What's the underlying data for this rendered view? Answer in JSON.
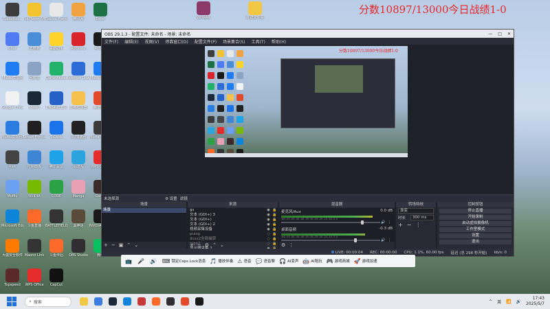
{
  "overlay": {
    "score_text": "分数10897/13000今日战绩1-0"
  },
  "desktop_icons": [
    {
      "label": "Rabbitbo...",
      "color": "#3d3d3d"
    },
    {
      "label": "PotPlayer 64 bit",
      "color": "#f4c430"
    },
    {
      "label": "Roblox Player",
      "color": "#e8e8e8"
    },
    {
      "label": "腾讯网",
      "color": "#f2a341"
    },
    {
      "label": "Excel",
      "color": "#1e7145"
    },
    {
      "label": "Chat",
      "color": "#4f7cf2"
    },
    {
      "label": "此电脑",
      "color": "#4a8ed8"
    },
    {
      "label": "毒霸助手",
      "color": "#ffd42a"
    },
    {
      "label": "Roblox 2",
      "color": "#d8242a"
    },
    {
      "label": "Roblox",
      "color": "#1a1a1a"
    },
    {
      "label": "MuMu模拟器",
      "color": "#1f7cf3"
    },
    {
      "label": "回收站",
      "color": "#8ba4c4"
    },
    {
      "label": "GameViewer",
      "color": "#23b26a"
    },
    {
      "label": "Internet Download...",
      "color": "#2b6cd6"
    },
    {
      "label": "MuMu多开器",
      "color": "#1f7cf3"
    },
    {
      "label": "Google Chrome",
      "color": "#f2f2f2"
    },
    {
      "label": "Steam",
      "color": "#1b2838"
    },
    {
      "label": "DNF系统工具",
      "color": "#2561c7"
    },
    {
      "label": "雷电模拟器",
      "color": "#f6c24d"
    },
    {
      "label": "奥运会...",
      "color": "#e24a2a"
    },
    {
      "label": "MuMu模拟器12",
      "color": "#2a7de1"
    },
    {
      "label": "Street Fighter 6",
      "color": "#202020"
    },
    {
      "label": "ToDesk",
      "color": "#1a73e8"
    },
    {
      "label": "UU加速器",
      "color": "#222"
    },
    {
      "label": "Mortal Kombat",
      "color": "#3a3a3a"
    },
    {
      "label": "Riot",
      "color": "#444"
    },
    {
      "label": "控制面板",
      "color": "#3e86d3"
    },
    {
      "label": "腾讯会议",
      "color": "#1fa3e8"
    },
    {
      "label": "uu远程",
      "color": "#2ba3dc"
    },
    {
      "label": "WPS Office",
      "color": "#e62b2b"
    },
    {
      "label": "MuMu",
      "color": "#6ca0f0"
    },
    {
      "label": "NVIDIA",
      "color": "#76b900"
    },
    {
      "label": "CODE",
      "color": "#2ba245"
    },
    {
      "label": "Manga",
      "color": "#e8a0b4"
    },
    {
      "label": "Game",
      "color": "#3a2a2a"
    },
    {
      "label": "Microsoft Edge",
      "color": "#0c84d9"
    },
    {
      "label": "斗鱼直播",
      "color": "#ff6a2a"
    },
    {
      "label": "BATTLEFIELD",
      "color": "#333"
    },
    {
      "label": "黑神话",
      "color": "#5a4a3a"
    },
    {
      "label": "NVIDIA Broadcast",
      "color": "#1a1a1a"
    },
    {
      "label": "大疆安全软件",
      "color": "#ff7b00"
    },
    {
      "label": "Maono Link",
      "color": "#333"
    },
    {
      "label": "斗鱼伴侣",
      "color": "#ff6a2a"
    },
    {
      "label": "OBS Studio",
      "color": "#302e31"
    },
    {
      "label": "微信",
      "color": "#07c160"
    },
    {
      "label": "Topspeed",
      "color": "#5a2a2a"
    },
    {
      "label": "WPS Office",
      "color": "#e62b2b"
    },
    {
      "label": "CapCut",
      "color": "#111"
    }
  ],
  "top_files": [
    {
      "label": "WinRAR",
      "color": "#8b3a6a"
    },
    {
      "label": "新建文件夹",
      "color": "#f2c744"
    }
  ],
  "obs": {
    "title": "OBS 29.1.3 - 配置文件: 未命名 - 场景: 未命名",
    "menu": [
      "文件(F)",
      "编辑(E)",
      "视图(V)",
      "停靠窗口(D)",
      "配置文件(P)",
      "场景集合(S)",
      "工具(T)",
      "帮助(H)"
    ],
    "preview_score": "分数10897/13000今日战绩1-0",
    "context": {
      "no_source": "未选择源",
      "props": "⚙ 设置",
      "filters": "滤镜"
    },
    "scenes": {
      "title": "场景",
      "items": [
        "场景"
      ]
    },
    "sources": {
      "title": "来源",
      "items": [
        {
          "name": "gs",
          "hidden": false
        },
        {
          "name": "文本 (GDI+) 3",
          "hidden": false
        },
        {
          "name": "文本 (GDI+)",
          "hidden": false
        },
        {
          "name": "文本 (GDI+) 2",
          "hidden": false
        },
        {
          "name": "视频采集设备",
          "hidden": false
        },
        {
          "name": "puisg",
          "hidden": true
        },
        {
          "name": "dcsx2全局捕获",
          "hidden": true
        },
        {
          "name": "rsgo2",
          "hidden": true
        },
        {
          "name": "显示器采集 2",
          "hidden": false
        }
      ]
    },
    "mixer": {
      "title": "混音器",
      "channels": [
        {
          "name": "麦克风/Aux",
          "db": "0.0 dB",
          "level": 0.82
        },
        {
          "name": "桌面音频",
          "db": "-0.3 dB",
          "level": 0.75
        }
      ],
      "scale": "-60 -55 -50 -45 -40 -35 -30 -25 -20 -15 -10 -5 0"
    },
    "transitions": {
      "title": "转场特效",
      "type": "渐变",
      "duration_label": "时长",
      "duration": "300 ms"
    },
    "controls": {
      "title": "控制按钮",
      "buttons": [
        "停止直播",
        "开始录制",
        "启动虚拟摄像机",
        "工作室模式",
        "设置",
        "退出"
      ]
    },
    "status": {
      "live": "LIVE: 00:00:04",
      "rec": "REC: 00:00:00",
      "cpu": "CPU: 1.1%, 60.00 fps",
      "dropped": "延迟 (总 298 秒开始)",
      "kbps": "kb/s: 0"
    }
  },
  "floatbar": [
    {
      "icon": "📺",
      "label": ""
    },
    {
      "icon": "🎤",
      "label": ""
    },
    {
      "icon": "🔊",
      "label": ""
    },
    {
      "icon": "⌨",
      "label": "锁定Caps Lock消息"
    },
    {
      "icon": "🎵",
      "label": "播放伴奏"
    },
    {
      "icon": "⚠",
      "label": "语音"
    },
    {
      "icon": "💬",
      "label": "语音聊"
    },
    {
      "icon": "🎧",
      "label": "AI变声"
    },
    {
      "icon": "🤖",
      "label": "AI陪玩"
    },
    {
      "icon": "🎮",
      "label": "游戏商城"
    },
    {
      "icon": "🚀",
      "label": "游戏加速"
    }
  ],
  "taskbar": {
    "search": "搜索",
    "apps": [
      "#f2c744",
      "#3b7de0",
      "#1b2838",
      "#0c84d9",
      "#c43a3a",
      "#ff6a2a",
      "#302e31",
      "#e24a2a",
      "#1a1a1a"
    ],
    "tray": [
      "^",
      "英",
      "📶",
      "🔊"
    ],
    "time": "17:43",
    "date": "2025/5/7"
  }
}
